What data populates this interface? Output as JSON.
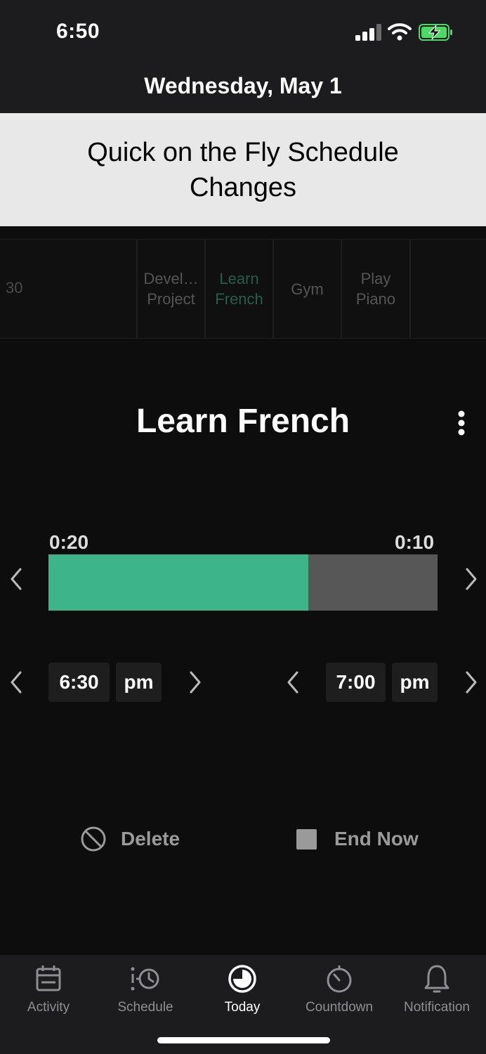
{
  "status": {
    "time": "6:50"
  },
  "header": {
    "date": "Wednesday, May 1"
  },
  "banner": {
    "text": "Quick on the Fly Schedule Changes"
  },
  "timeline": {
    "partial_left": "30",
    "items": [
      {
        "label_line1": "Devel…",
        "label_line2": "Project"
      },
      {
        "label_line1": "Learn",
        "label_line2": "French"
      },
      {
        "label_line1": "Gym",
        "label_line2": ""
      },
      {
        "label_line1": "Play",
        "label_line2": "Piano"
      }
    ]
  },
  "activity": {
    "title": "Learn French",
    "elapsed": "0:20",
    "remaining": "0:10",
    "progress_fraction": 0.667
  },
  "times": {
    "start_time": "6:30",
    "start_period": "pm",
    "end_time": "7:00",
    "end_period": "pm"
  },
  "actions": {
    "delete_label": "Delete",
    "end_now_label": "End Now"
  },
  "tabs": [
    {
      "label": "Activity",
      "icon": "calendar-icon"
    },
    {
      "label": "Schedule",
      "icon": "schedule-clock-icon"
    },
    {
      "label": "Today",
      "icon": "pie-clock-icon"
    },
    {
      "label": "Countdown",
      "icon": "stopwatch-icon"
    },
    {
      "label": "Notification",
      "icon": "bell-icon"
    }
  ],
  "colors": {
    "accent": "#3db489",
    "track": "#575757",
    "active_timeline_text": "#245d48"
  }
}
